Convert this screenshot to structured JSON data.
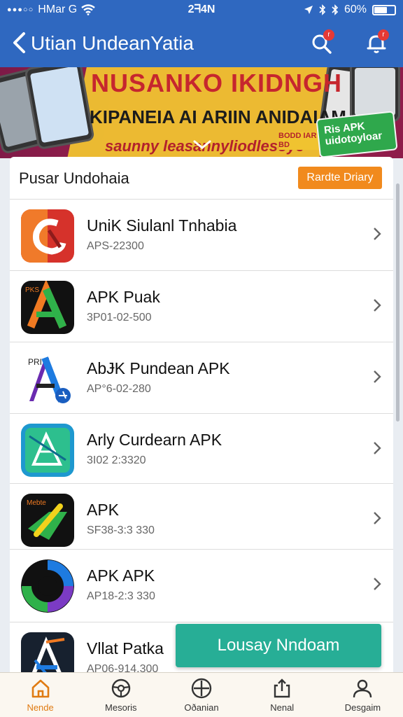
{
  "status_bar": {
    "carrier": "HMar G",
    "time": "2ᖷ4N",
    "battery": "60%",
    "battery_level": 0.6
  },
  "app_bar": {
    "title": "Utian UndeanYatia",
    "search_badge": "r",
    "bell_badge": "r"
  },
  "banner": {
    "line1": "NUSANKO IKIDNGH",
    "line2": "KIPANEIA AI ARIIN ANIDAIAM",
    "line3": "saunny leasannyliodlesoye",
    "cta_label": "Ris APK uidotoyloar",
    "small_text": "BODD IAR BD"
  },
  "section": {
    "title": "Pusar Undohaia",
    "action_label": "Rardte Driary"
  },
  "apps": [
    {
      "name": "UniK Siulanl Tnhabia",
      "meta": "APS-22300",
      "icon": "red-brand-icon"
    },
    {
      "name": "APK Puak",
      "meta": "3P01-02-500",
      "icon": "green-a-icon"
    },
    {
      "name": "AbɈK Pundean  APK",
      "meta": "AP°6-02-280",
      "icon": "purple-a-icon"
    },
    {
      "name": "Arly Curdearn  APK",
      "meta": "3I02 2:3320",
      "icon": "teal-a-icon"
    },
    {
      "name": "APK",
      "meta": "SF38-3:3 330",
      "icon": "green-arrow-icon"
    },
    {
      "name": "APK APK",
      "meta": "AP18-2:3 330",
      "icon": "ring-icon"
    },
    {
      "name": "Vllat Patka",
      "meta": "AP06-914.300",
      "icon": "blue-a-icon"
    }
  ],
  "download_button": "Lousay Nndoam",
  "tabs": [
    {
      "label": "Nende",
      "icon": "home-icon",
      "active": true
    },
    {
      "label": "Mesoris",
      "icon": "wheel-icon",
      "active": false
    },
    {
      "label": "Oðanian",
      "icon": "plus-circle-icon",
      "active": false
    },
    {
      "label": "Nenal",
      "icon": "share-icon",
      "active": false
    },
    {
      "label": "Desgaim",
      "icon": "person-icon",
      "active": false
    }
  ],
  "colors": {
    "primary": "#2f68c0",
    "accent": "#f18a1d",
    "download": "#27ae96",
    "active_tab": "#e07b12"
  }
}
